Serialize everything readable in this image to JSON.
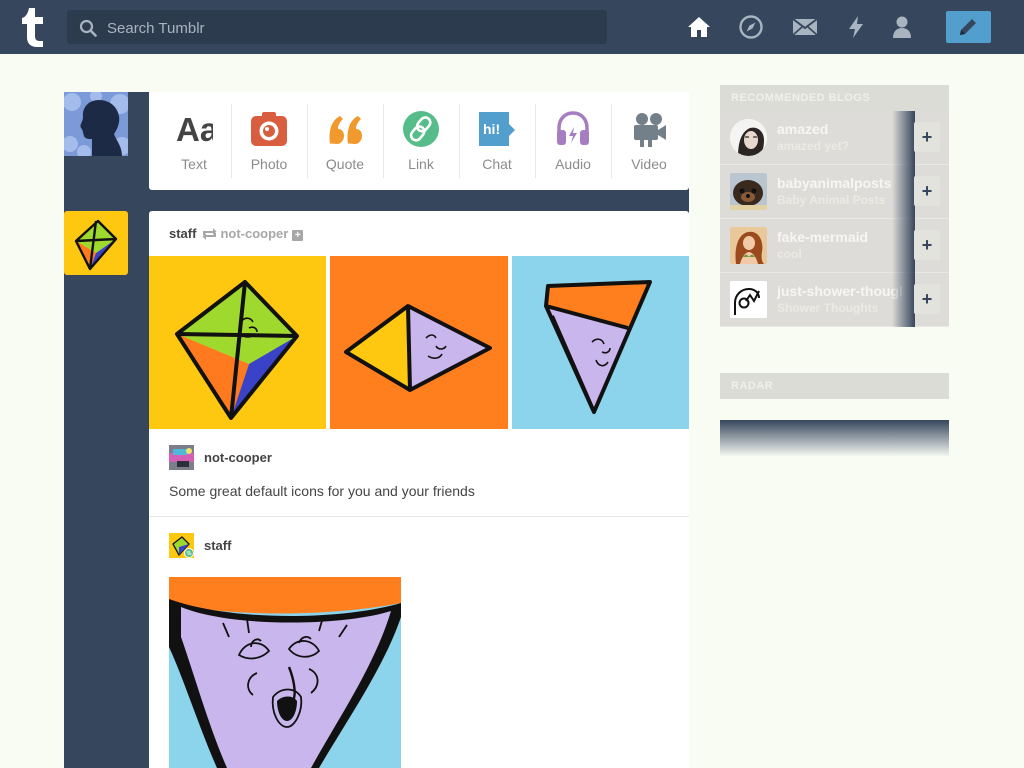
{
  "topbar": {
    "search_placeholder": "Search Tumblr",
    "nav_icons": [
      "home-icon",
      "explore-icon",
      "inbox-icon",
      "activity-icon",
      "account-icon"
    ],
    "compose_icon": "pencil-icon",
    "colors": {
      "bar": "#36465d",
      "compose": "#529ecc"
    }
  },
  "post_form": {
    "items": [
      {
        "label": "Text",
        "icon": "text-icon",
        "color": "#444444"
      },
      {
        "label": "Photo",
        "icon": "photo-icon",
        "color": "#d95e40"
      },
      {
        "label": "Quote",
        "icon": "quote-icon",
        "color": "#f2992e"
      },
      {
        "label": "Link",
        "icon": "link-icon",
        "color": "#56bc8a"
      },
      {
        "label": "Chat",
        "icon": "chat-icon",
        "color": "#529ecc",
        "badge": "hi!"
      },
      {
        "label": "Audio",
        "icon": "audio-icon",
        "color": "#a77dc2"
      },
      {
        "label": "Video",
        "icon": "video-icon",
        "color": "#748089"
      }
    ]
  },
  "post": {
    "blog": "staff",
    "reblogged_from": "not-cooper",
    "follow_glyph": "+",
    "reblog": {
      "name": "not-cooper",
      "caption": "Some great default icons for you and your friends"
    },
    "original": {
      "name": "staff"
    }
  },
  "sidebar": {
    "recommended_title": "Recommended Blogs",
    "recommended": [
      {
        "name": "amazed",
        "subtitle": "amazed yet?",
        "follow": "+"
      },
      {
        "name": "babyanimalposts",
        "subtitle": "Baby Animal Posts",
        "follow": "+"
      },
      {
        "name": "fake-mermaid",
        "subtitle": "cool",
        "follow": "+"
      },
      {
        "name": "just-shower-thoughts",
        "subtitle": "Shower Thoughts",
        "follow": "+"
      }
    ],
    "radar_title": "Radar"
  }
}
